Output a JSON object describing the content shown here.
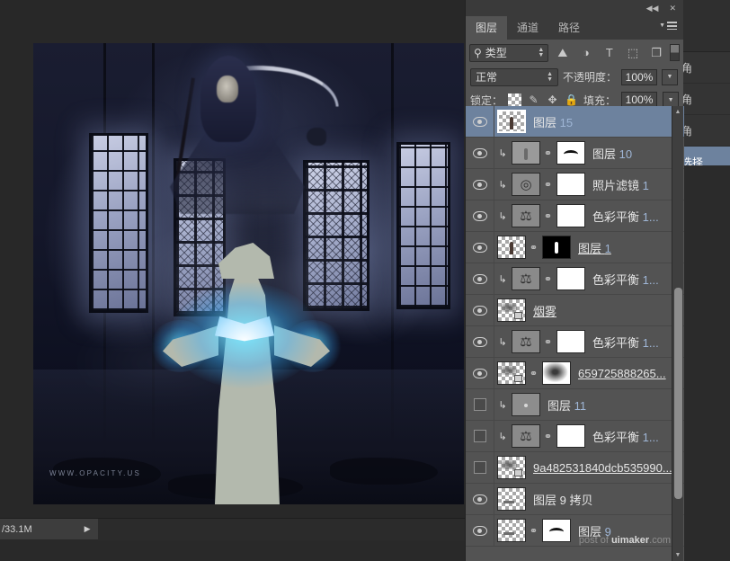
{
  "app": {
    "status_zoom": "/33.1M",
    "canvas_watermark": "WWW.OPACITY.US",
    "panel_watermark_prefix": "post of ",
    "panel_watermark_brand": "uimaker",
    "panel_watermark_suffix": ".com"
  },
  "panel": {
    "collapse_icon": "◀◀",
    "close_icon": "✕",
    "tabs": [
      {
        "label": "图层",
        "active": true
      },
      {
        "label": "通道",
        "active": false
      },
      {
        "label": "路径",
        "active": false
      }
    ],
    "filter": {
      "search_icon": "⚲",
      "type_label": "类型",
      "buttons": [
        {
          "name": "pixel-layer-filter",
          "glyph": "⛰"
        },
        {
          "name": "adjustment-layer-filter",
          "glyph": "◑"
        },
        {
          "name": "type-layer-filter",
          "glyph": "T"
        },
        {
          "name": "shape-layer-filter",
          "glyph": "⬚"
        },
        {
          "name": "smart-object-filter",
          "glyph": "❐"
        }
      ]
    },
    "blend_mode": "正常",
    "opacity_label": "不透明度：",
    "opacity_value": "100%",
    "lock_label": "锁定：",
    "lock_icons": [
      {
        "name": "lock-transparent-pixels-icon",
        "glyph": ""
      },
      {
        "name": "lock-image-pixels-icon",
        "glyph": "✎"
      },
      {
        "name": "lock-position-icon",
        "glyph": "✥"
      },
      {
        "name": "lock-all-icon",
        "glyph": "🔒"
      }
    ],
    "fill_label": "填充：",
    "fill_value": "100%"
  },
  "layers": [
    {
      "name": "图层",
      "num": "15",
      "visible": true,
      "selected": true,
      "clipped": false,
      "thumb": "figure",
      "mask": null,
      "link": false,
      "underline": false
    },
    {
      "name": "图层",
      "num": "10",
      "visible": true,
      "selected": false,
      "clipped": true,
      "thumb": "grayfigure",
      "mask": "curve",
      "link": true,
      "underline": false
    },
    {
      "name": "照片滤镜",
      "num": "1",
      "visible": true,
      "selected": false,
      "clipped": true,
      "thumb": "photofilter",
      "mask": "white",
      "link": true,
      "underline": false
    },
    {
      "name": "色彩平衡",
      "num": "1...",
      "visible": true,
      "selected": false,
      "clipped": true,
      "thumb": "balance",
      "mask": "white",
      "link": true,
      "underline": false
    },
    {
      "name": "图层",
      "num": "1",
      "visible": true,
      "selected": false,
      "clipped": false,
      "thumb": "figure",
      "mask": "black",
      "link": true,
      "underline": true
    },
    {
      "name": "色彩平衡",
      "num": "1...",
      "visible": true,
      "selected": false,
      "clipped": true,
      "thumb": "balance",
      "mask": "white",
      "link": true,
      "underline": false
    },
    {
      "name": "烟雾",
      "num": "",
      "visible": true,
      "selected": false,
      "clipped": false,
      "thumb": "smoke",
      "mask": null,
      "link": false,
      "underline": true
    },
    {
      "name": "色彩平衡",
      "num": "1...",
      "visible": true,
      "selected": false,
      "clipped": true,
      "thumb": "balance",
      "mask": "white",
      "link": true,
      "underline": false
    },
    {
      "name": "659725888265...",
      "num": "",
      "visible": true,
      "selected": false,
      "clipped": false,
      "thumb": "smoke",
      "mask": "softmask",
      "link": true,
      "underline": true
    },
    {
      "name": "图层",
      "num": "11",
      "visible": false,
      "selected": false,
      "clipped": true,
      "thumb": "graydot",
      "mask": null,
      "link": false,
      "underline": false
    },
    {
      "name": "色彩平衡",
      "num": "1...",
      "visible": false,
      "selected": false,
      "clipped": true,
      "thumb": "balance",
      "mask": "white",
      "link": true,
      "underline": false
    },
    {
      "name": "9a482531840dcb535990...",
      "num": "",
      "visible": false,
      "selected": false,
      "clipped": false,
      "thumb": "smoke",
      "mask": null,
      "link": false,
      "underline": true
    },
    {
      "name": "图层 9 拷贝",
      "num": "",
      "visible": true,
      "selected": false,
      "clipped": false,
      "thumb": "empty",
      "mask": null,
      "link": false,
      "underline": false
    },
    {
      "name": "图层",
      "num": "9",
      "visible": true,
      "selected": false,
      "clipped": false,
      "thumb": "empty",
      "mask": "curve",
      "link": true,
      "underline": false
    }
  ],
  "background_panel": {
    "rows": [
      "角",
      "角",
      "角"
    ],
    "selected_row": "选择"
  }
}
